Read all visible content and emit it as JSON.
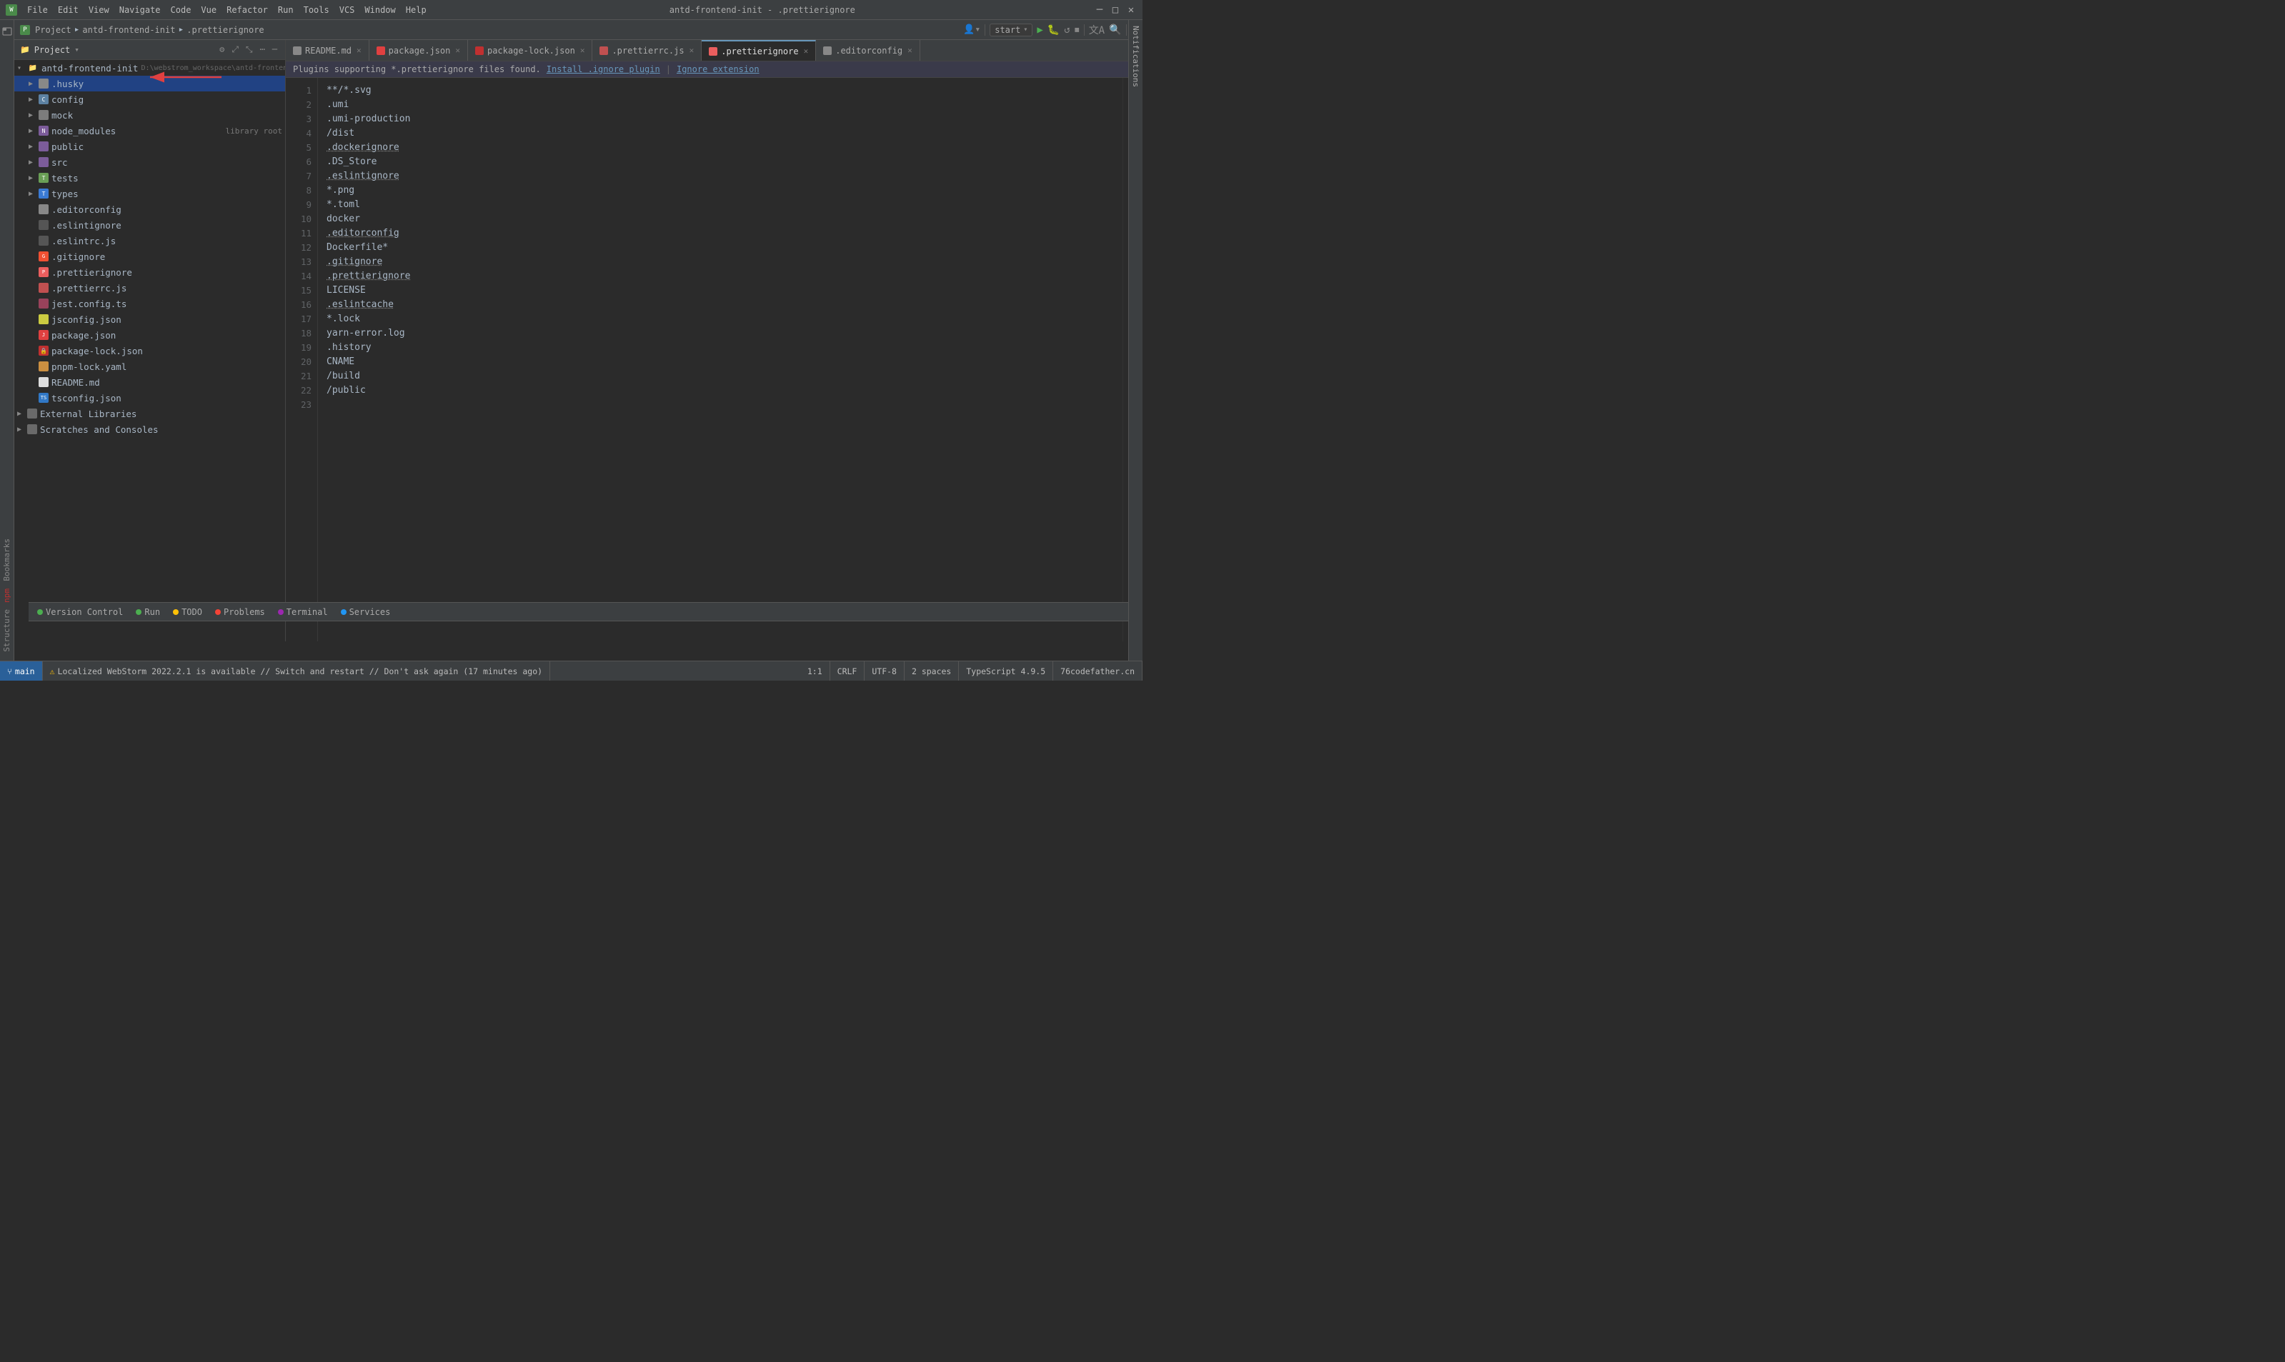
{
  "window": {
    "title": "antd-frontend-init - .prettierignore",
    "controls": {
      "minimize": "─",
      "maximize": "□",
      "close": "✕"
    }
  },
  "menu": {
    "items": [
      "File",
      "Edit",
      "View",
      "Navigate",
      "Code",
      "Vue",
      "Refactor",
      "Run",
      "Tools",
      "VCS",
      "Window",
      "Help"
    ]
  },
  "breadcrumb": {
    "project": "antd-frontend-init",
    "path": "D:\\webstrom_workspace\\antd-frontend-init - ",
    "file": ".prettierignore"
  },
  "sidebar": {
    "title": "Project",
    "root": "antd-frontend-init",
    "root_path": "D:\\webstrom_workspace\\antd-frontend-init",
    "items": [
      {
        "name": ".husky",
        "type": "folder",
        "level": 1,
        "expanded": false,
        "selected": true
      },
      {
        "name": "config",
        "type": "config",
        "level": 1,
        "expanded": false
      },
      {
        "name": "mock",
        "type": "folder",
        "level": 1,
        "expanded": false
      },
      {
        "name": "node_modules",
        "type": "node_modules",
        "level": 1,
        "expanded": false,
        "extra": "library root"
      },
      {
        "name": "public",
        "type": "folder_purple",
        "level": 1,
        "expanded": false
      },
      {
        "name": "src",
        "type": "folder_purple",
        "level": 1,
        "expanded": false
      },
      {
        "name": "tests",
        "type": "tests",
        "level": 1,
        "expanded": false
      },
      {
        "name": "types",
        "type": "types",
        "level": 1,
        "expanded": false
      },
      {
        "name": ".editorconfig",
        "type": "editorconfig",
        "level": 1
      },
      {
        "name": ".eslintignore",
        "type": "eslintignore",
        "level": 1
      },
      {
        "name": ".eslintrc.js",
        "type": "eslintrc",
        "level": 1
      },
      {
        "name": ".gitignore",
        "type": "gitignore",
        "level": 1
      },
      {
        "name": ".prettierignore",
        "type": "prettier",
        "level": 1
      },
      {
        "name": ".prettierrc.js",
        "type": "prettier2",
        "level": 1
      },
      {
        "name": "jest.config.ts",
        "type": "jest",
        "level": 1
      },
      {
        "name": "jsconfig.json",
        "type": "json",
        "level": 1
      },
      {
        "name": "package.json",
        "type": "package",
        "level": 1
      },
      {
        "name": "package-lock.json",
        "type": "package_lock",
        "level": 1
      },
      {
        "name": "pnpm-lock.yaml",
        "type": "yaml",
        "level": 1
      },
      {
        "name": "README.md",
        "type": "readme",
        "level": 1
      },
      {
        "name": "tsconfig.json",
        "type": "ts",
        "level": 1
      },
      {
        "name": "External Libraries",
        "type": "external",
        "level": 0
      },
      {
        "name": "Scratches and Consoles",
        "type": "scratches",
        "level": 0
      }
    ]
  },
  "tabs": [
    {
      "id": "readme",
      "label": "README.md",
      "icon": "md",
      "active": false,
      "modified": false
    },
    {
      "id": "package_json",
      "label": "package.json",
      "icon": "json",
      "active": false,
      "modified": false
    },
    {
      "id": "package_lock",
      "label": "package-lock.json",
      "icon": "lock",
      "active": false,
      "modified": false
    },
    {
      "id": "prettierrc",
      "label": ".prettierrc.js",
      "icon": "prettier",
      "active": false,
      "modified": false
    },
    {
      "id": "prettierignore",
      "label": ".prettierignore",
      "icon": "prettier",
      "active": true,
      "modified": false
    },
    {
      "id": "editorconfig",
      "label": ".editorconfig",
      "icon": "editorconfig",
      "active": false,
      "modified": false
    }
  ],
  "notification": {
    "text": "Plugins supporting *.prettierignore files found.",
    "link1": "Install .ignore plugin",
    "link2": "Ignore extension"
  },
  "editor": {
    "filename": ".prettierignore",
    "lines": [
      "**/*.svg",
      ".umi",
      ".umi-production",
      "/dist",
      ".dockerignore",
      ".DS_Store",
      ".eslintignore",
      "*.png",
      "*.toml",
      "docker",
      ".editorconfig",
      "Dockerfile*",
      ".gitignore",
      ".prettierignore",
      "LICENSE",
      ".eslintcache",
      "*.lock",
      "yarn-error.log",
      ".history",
      "CNAME",
      "/build",
      "/public",
      ""
    ]
  },
  "status_bar": {
    "version_control": "Version Control",
    "run": "Run",
    "todo": "TODO",
    "problems": "Problems",
    "terminal": "Terminal",
    "services": "Services",
    "position": "1:1",
    "line_ending": "CRLF",
    "encoding": "UTF-8",
    "indent": "2 spaces",
    "file_type": "TypeScript 4.9.5",
    "plugin": "76codefather.cn"
  },
  "run_config": {
    "label": "start",
    "play": "▶",
    "icons": [
      "↺",
      "⏸",
      "⏹",
      "Aa",
      "⌕",
      "⟩"
    ]
  },
  "bookmarks_label": "Bookmarks",
  "npm_label": "npm",
  "structure_label": "Structure"
}
